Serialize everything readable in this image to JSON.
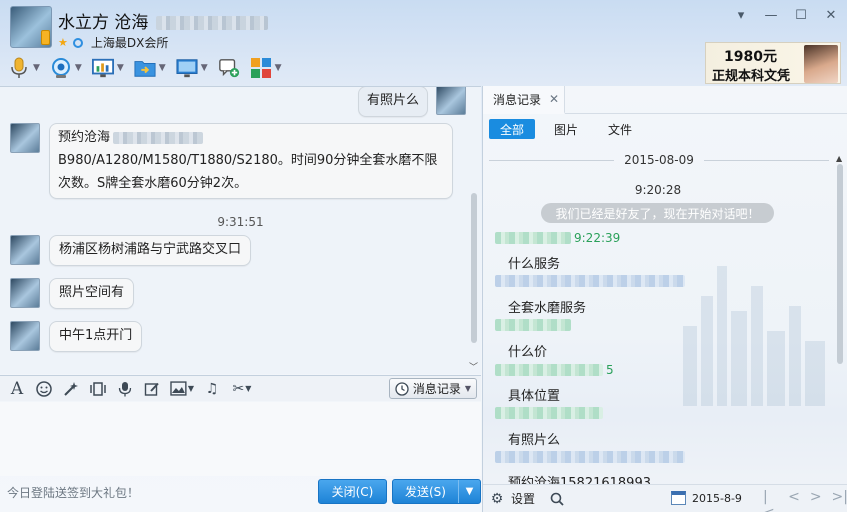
{
  "header": {
    "contact_name": "水立方 沧海",
    "group": "上海最DX会所",
    "controls": [
      "▾",
      "—",
      "☐",
      "✕"
    ]
  },
  "toolbar": {
    "items": [
      "microphone-icon",
      "video-icon",
      "screen-share-icon",
      "file-transfer-icon",
      "remote-desktop-icon",
      "group-chat-icon",
      "apps-icon"
    ]
  },
  "ad": {
    "price": "1980元",
    "text": "正规本科文凭"
  },
  "chat": {
    "self_message": "有照片么",
    "messages": [
      {
        "line1": "预约沧海",
        "line2": "B980/A1280/M1580/T1880/S2180。时间90分钟全套水磨不限",
        "line3": "次数。S牌全套水磨60分钟2次。"
      },
      {
        "text": "杨浦区杨树浦路与宁武路交叉口"
      },
      {
        "text": "照片空间有"
      },
      {
        "text": "中午1点开门"
      }
    ],
    "time": "9:31:51"
  },
  "input": {
    "msglog_label": "消息记录",
    "promo": "今日登陆送签到大礼包！",
    "close_label": "关闭(C)",
    "send_label": "发送(S)"
  },
  "history": {
    "tab_label": "消息记录",
    "filters": [
      "全部",
      "图片",
      "文件"
    ],
    "date": "2015-08-09",
    "first_time": "9:20:28",
    "system_msg": "我们已经是好友了，现在开始对话吧！",
    "sender_time": "9:22:39",
    "entries": [
      "什么服务",
      "全套水磨服务",
      "什么价",
      "具体位置",
      "有照片么"
    ],
    "partial_time_suffix": "5",
    "last_partial": "预约沧海15821618993",
    "settings_label": "设置",
    "bottom_date": "2015-8-9"
  }
}
